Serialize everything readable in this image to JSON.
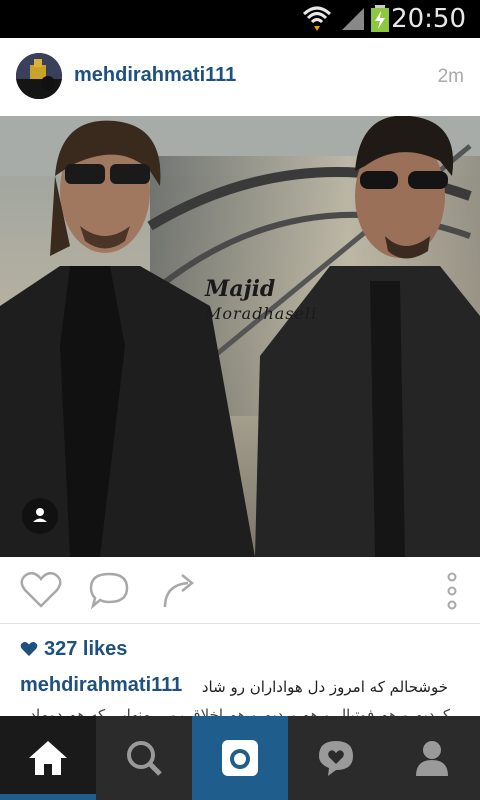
{
  "status_bar": {
    "time": "20:50"
  },
  "post": {
    "username": "mehdirahmati111",
    "time_ago": "2m",
    "photo_watermark": {
      "line1": "Majid",
      "line2": "Moradhaseli"
    },
    "likes": "327 likes",
    "caption_username": "mehdirahmati111",
    "caption_text": "خوشحالم که امروز دل هواداران رو شاد",
    "caption_text_line2": "کردیم و هم فوتبال و هم بردیم و هم اخلاق رو... منهایی که هم دوماد"
  },
  "navbar": {
    "items": [
      "home",
      "search",
      "camera",
      "activity",
      "profile"
    ]
  },
  "colors": {
    "brand_blue": "#1e5080",
    "nav_active": "#1f5d8c",
    "nav_bg": "#2b2b2b"
  }
}
